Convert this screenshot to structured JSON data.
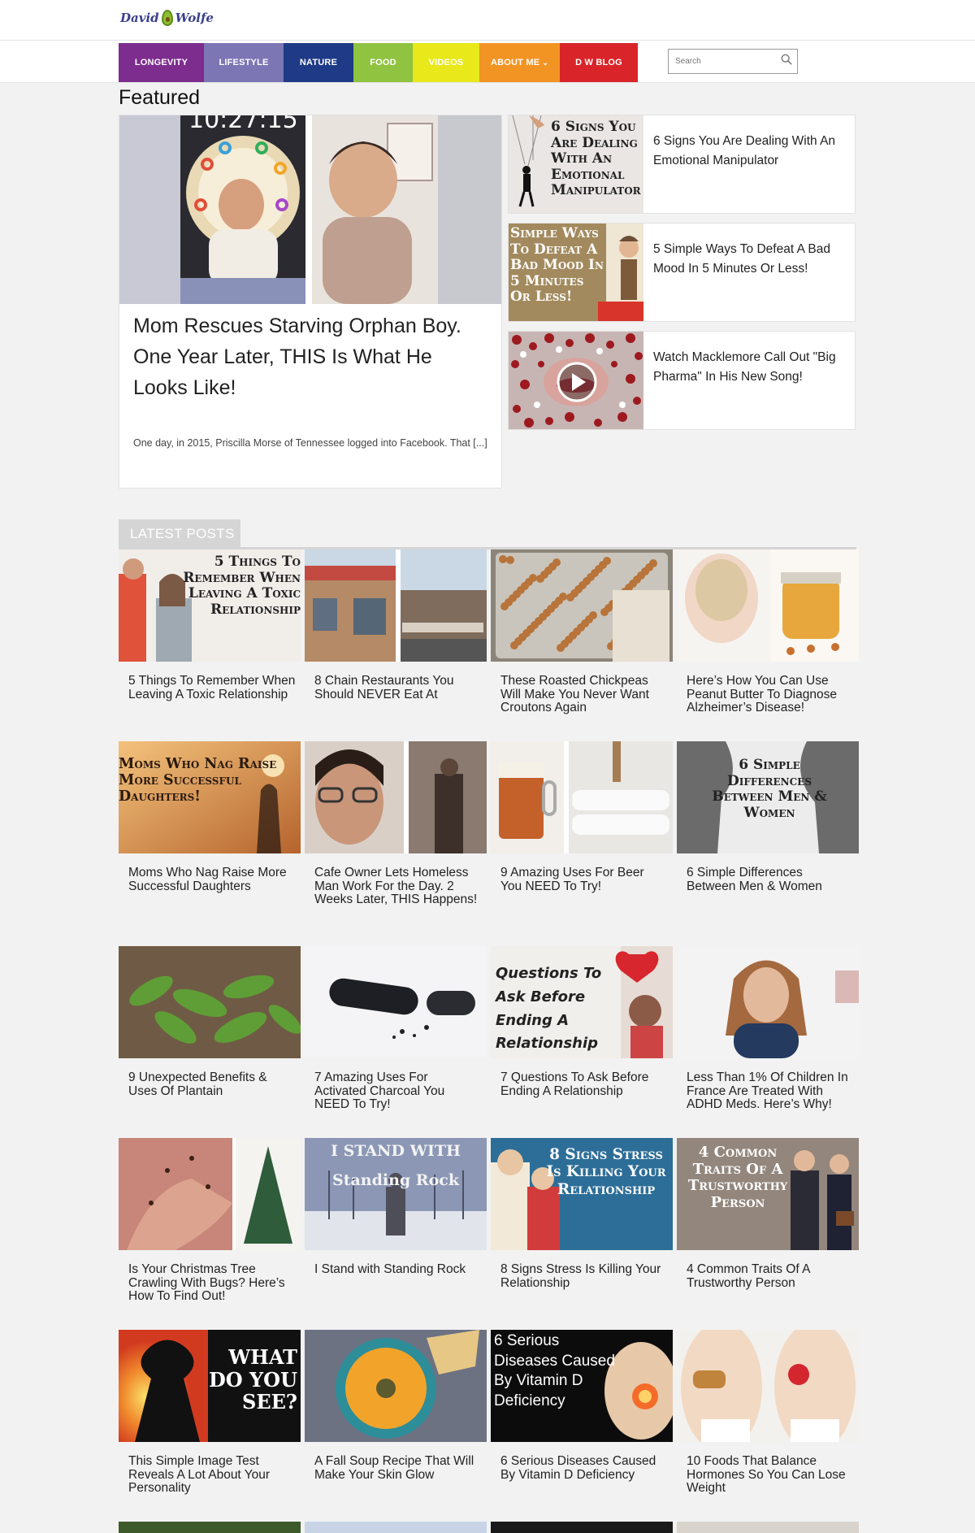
{
  "header": {
    "logo_text_left": "David",
    "logo_text_right": "Wolfe"
  },
  "nav": {
    "items": [
      {
        "label": "LONGEVITY",
        "color": "#7d2d8e",
        "width": 105
      },
      {
        "label": "LIFESTYLE",
        "color": "#7c76b4",
        "width": 98
      },
      {
        "label": "NATURE",
        "color": "#1f3a86",
        "width": 86
      },
      {
        "label": "FOOD",
        "color": "#8fc340",
        "width": 73
      },
      {
        "label": "VIDEOS",
        "color": "#e8e81a",
        "width": 82
      },
      {
        "label": "ABOUT ME",
        "color": "#f29423",
        "width": 99
      },
      {
        "label": "D W BLOG",
        "color": "#d9252a",
        "width": 96
      }
    ],
    "about_caret": "⌄"
  },
  "search": {
    "placeholder": "Search"
  },
  "featured": {
    "heading": "Featured",
    "main": {
      "timestamp_overlay": "10:27:15",
      "headline": "Mom Rescues Starving Orphan Boy. One Year Later, THIS Is What He Looks Like!",
      "excerpt": "One day, in 2015, Priscilla Morse of Tennessee logged into Facebook. That [...]"
    },
    "side": [
      {
        "title": "6 Signs You Are Dealing With An Emotional Manipulator",
        "thumb_text": "6 Signs You Are Dealing With An Emotional Manipulator"
      },
      {
        "title": "5 Simple Ways To Defeat A Bad Mood In 5 Minutes Or Less!",
        "thumb_text": "Simple Ways To Defeat A Bad Mood In 5 Minutes Or Less!"
      },
      {
        "title": "Watch Macklemore Call Out \"Big Pharma\" In His New Song!",
        "thumb_text": ""
      }
    ]
  },
  "latest": {
    "heading": "LATEST POSTS",
    "posts": [
      {
        "title": "5 Things To Remember When Leaving A Toxic Relationship",
        "overlay": "5 Things To Remember When Leaving A Toxic Relationship"
      },
      {
        "title": "8 Chain Restaurants You Should NEVER Eat At",
        "overlay": ""
      },
      {
        "title": "These Roasted Chickpeas Will Make You Never Want Croutons Again",
        "overlay": ""
      },
      {
        "title": "Here’s How You Can Use Peanut Butter To Diagnose Alzheimer’s Disease!",
        "overlay": ""
      },
      {
        "title": "Moms Who Nag Raise More Successful Daughters",
        "overlay": "Moms Who Nag Raise More Successful Daughters!"
      },
      {
        "title": "Cafe Owner Lets Homeless Man Work For the Day. 2 Weeks Later, THIS Happens!",
        "overlay": ""
      },
      {
        "title": "9 Amazing Uses For Beer You NEED To Try!",
        "overlay": ""
      },
      {
        "title": "6 Simple Differences Between Men & Women",
        "overlay": "6 Simple Differences Between Men & Women"
      },
      {
        "title": "9 Unexpected Benefits & Uses Of Plantain",
        "overlay": ""
      },
      {
        "title": "7 Amazing Uses For Activated Charcoal You NEED To Try!",
        "overlay": ""
      },
      {
        "title": "7 Questions To Ask Before Ending A Relationship",
        "overlay": "Questions To Ask Before Ending A Relationship"
      },
      {
        "title": "Less Than 1% Of Children In France Are Treated With ADHD Meds. Here’s Why!",
        "overlay": ""
      },
      {
        "title": "Is Your Christmas Tree Crawling With Bugs? Here’s How To Find Out!",
        "overlay": ""
      },
      {
        "title": "I Stand with Standing Rock",
        "overlay": "I STAND WITH Standing Rock"
      },
      {
        "title": "8 Signs Stress Is Killing Your Relationship",
        "overlay": "8 Signs Stress Is Killing Your Relationship"
      },
      {
        "title": "4 Common Traits Of A Trustworthy Person",
        "overlay": "4 Common Traits Of A Trustworthy Person"
      },
      {
        "title": "This Simple Image Test Reveals A Lot About Your Personality",
        "overlay": "WHAT DO YOU SEE?"
      },
      {
        "title": "A Fall Soup Recipe That Will Make Your Skin Glow",
        "overlay": ""
      },
      {
        "title": "6 Serious Diseases Caused By Vitamin D Deficiency",
        "overlay": "6 Serious Diseases Caused By Vitamin D Deficiency"
      },
      {
        "title": "10 Foods That Balance Hormones So You Can Lose Weight",
        "overlay": ""
      }
    ]
  }
}
